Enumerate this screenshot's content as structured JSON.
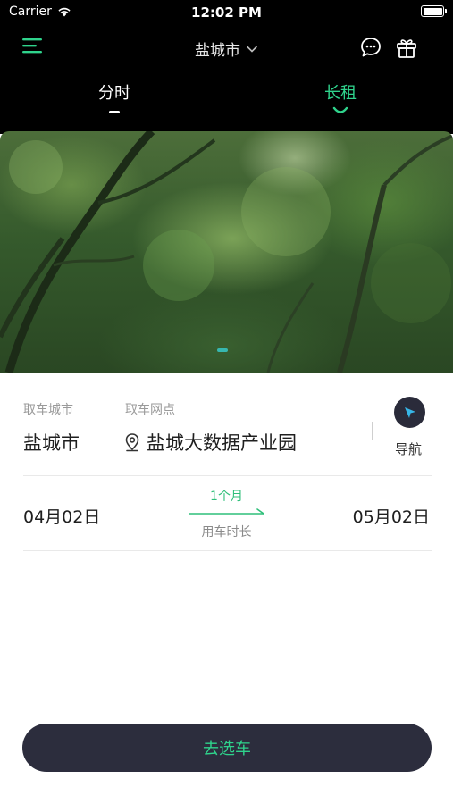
{
  "status_bar": {
    "carrier": "Carrier",
    "time": "12:02 PM"
  },
  "nav": {
    "city": "盐城市",
    "menu_icon": "menu-icon",
    "chat_icon": "chat-bubble-icon",
    "gift_icon": "gift-icon"
  },
  "tabs": [
    {
      "label": "分时",
      "active": false
    },
    {
      "label": "长租",
      "active": true
    }
  ],
  "form": {
    "pickup_city_label": "取车城市",
    "pickup_city": "盐城市",
    "pickup_store_label": "取车网点",
    "pickup_store": "盐城大数据产业园",
    "navigate_label": "导航",
    "start_date": "04月02日",
    "end_date": "05月02日",
    "duration": "1个月",
    "duration_label": "用车时长"
  },
  "action": {
    "select_car": "去选车"
  },
  "colors": {
    "accent": "#2fd38c",
    "dark": "#2c2d3d",
    "top_bg": "#000000"
  }
}
